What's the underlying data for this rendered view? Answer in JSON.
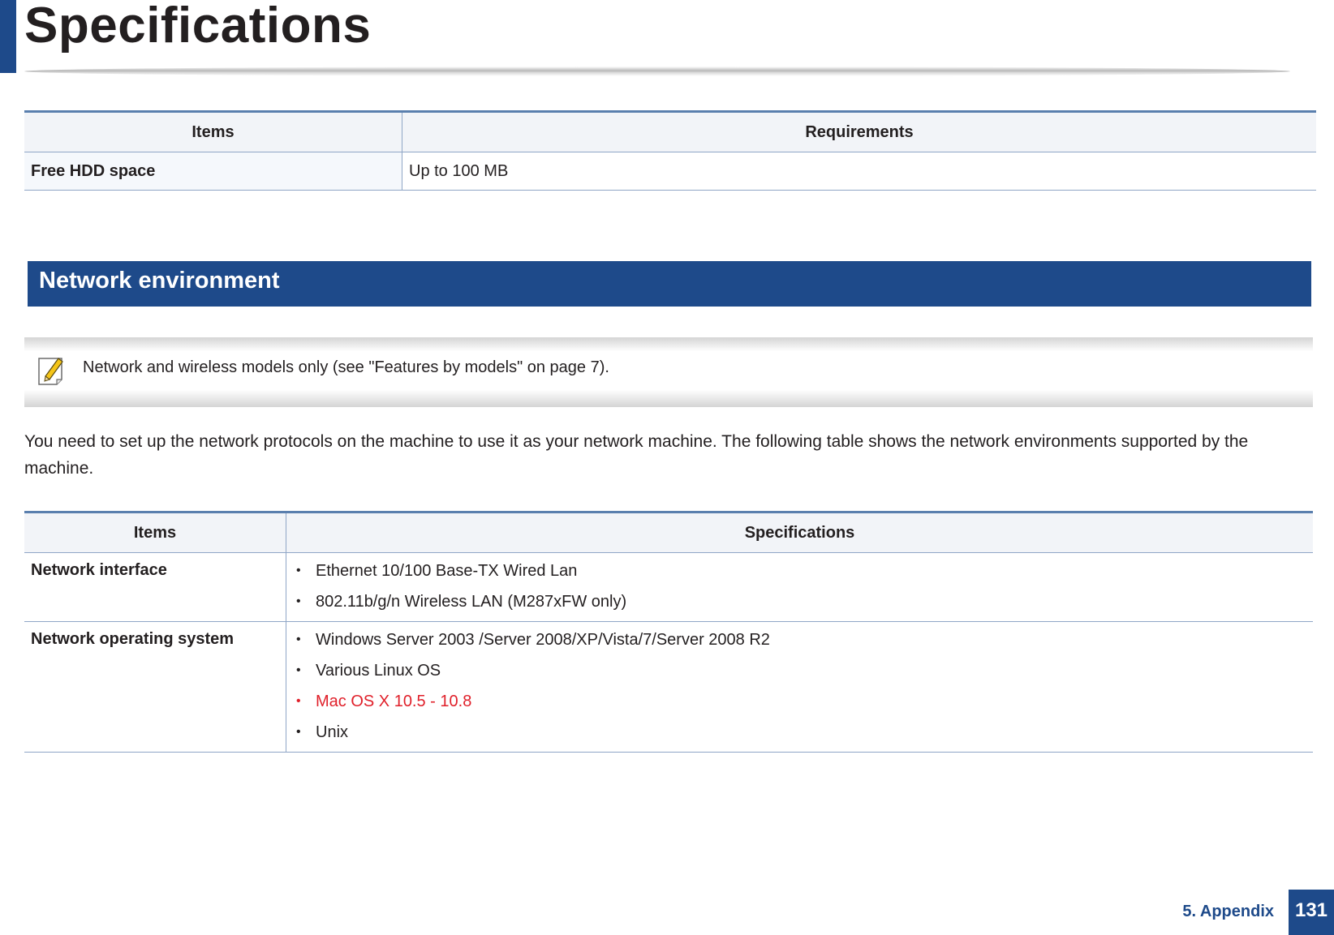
{
  "page_title": "Specifications",
  "table1": {
    "headers": [
      "Items",
      "Requirements"
    ],
    "rows": [
      {
        "item": "Free HDD space",
        "value": "Up to 100 MB"
      }
    ]
  },
  "section": {
    "title": "Network environment"
  },
  "note": {
    "text": "Network and wireless models only (see \"Features by models\" on page 7)."
  },
  "paragraph": "You need to set up the network protocols on the machine to use it as your network machine. The following table shows the network environments supported by the machine.",
  "table2": {
    "headers": [
      "Items",
      "Specifications"
    ],
    "rows": [
      {
        "item": "Network interface",
        "values": [
          "Ethernet 10/100 Base-TX Wired Lan",
          "802.11b/g/n Wireless LAN (M287xFW only)"
        ]
      },
      {
        "item": "Network operating system",
        "values": [
          "Windows Server 2003 /Server 2008/XP/Vista/7/Server 2008 R2",
          "Various Linux OS",
          "Mac OS X 10.5 - 10.8",
          "Unix"
        ]
      }
    ]
  },
  "footer": {
    "label": "5.  Appendix",
    "page_number": "131"
  },
  "colors": {
    "brand_blue": "#1e4a8a",
    "highlight_red": "#e0202a"
  }
}
